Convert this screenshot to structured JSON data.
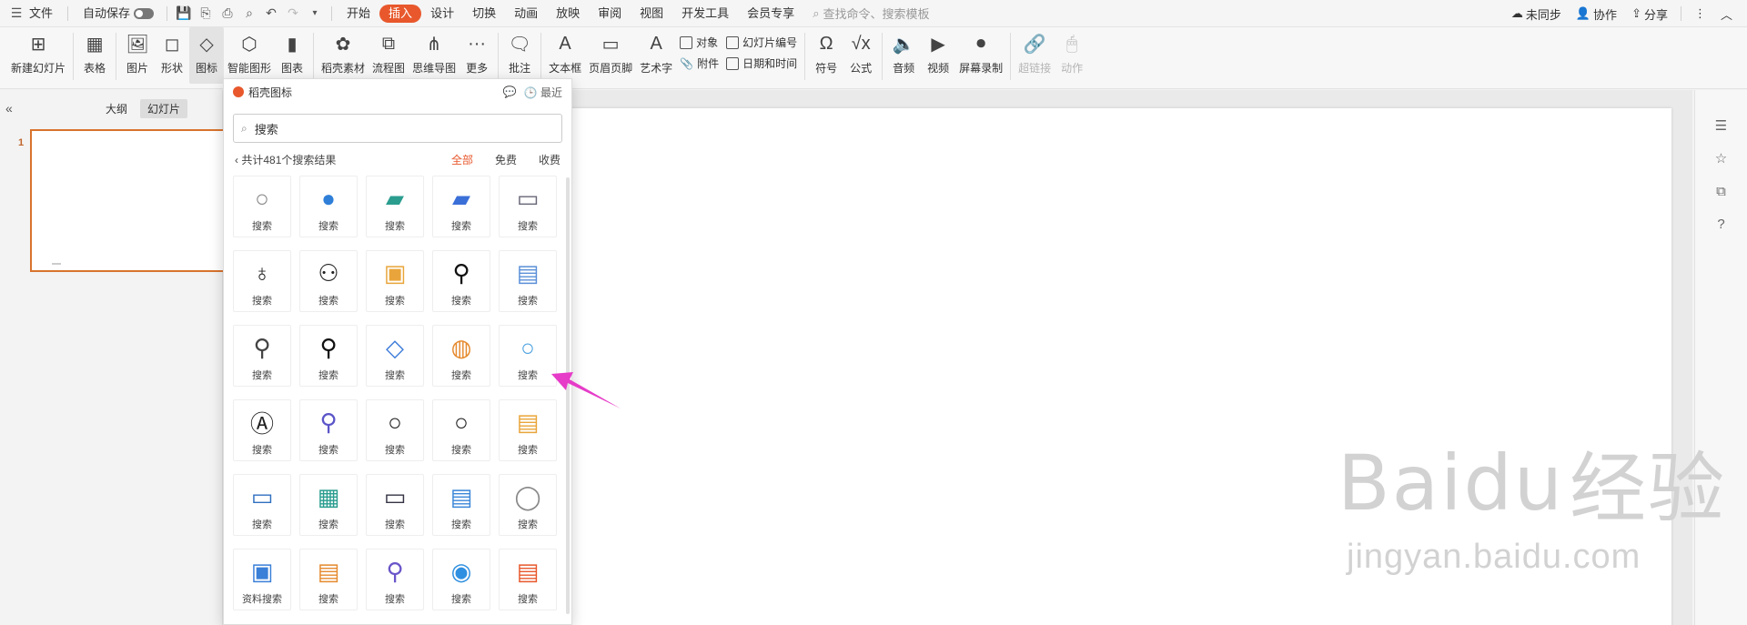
{
  "menubar": {
    "file": "文件",
    "autosave": "自动保存",
    "tabs": [
      {
        "label": "开始",
        "active": false
      },
      {
        "label": "插入",
        "active": true
      },
      {
        "label": "设计",
        "active": false
      },
      {
        "label": "切换",
        "active": false
      },
      {
        "label": "动画",
        "active": false
      },
      {
        "label": "放映",
        "active": false
      },
      {
        "label": "审阅",
        "active": false
      },
      {
        "label": "视图",
        "active": false
      },
      {
        "label": "开发工具",
        "active": false
      },
      {
        "label": "会员专享",
        "active": false
      }
    ],
    "search_placeholder": "查找命令、搜索模板",
    "sync": "未同步",
    "collab": "协作",
    "share": "分享"
  },
  "ribbon": {
    "new_slide": "新建幻灯片",
    "table": "表格",
    "picture": "图片",
    "shape": "形状",
    "icon": "图标",
    "smart_graphic": "智能图形",
    "chart": "图表",
    "assets": "稻壳素材",
    "flowchart": "流程图",
    "mindmap": "思维导图",
    "more": "更多",
    "comment": "批注",
    "textbox": "文本框",
    "header_footer": "页眉页脚",
    "wordart": "艺术字",
    "object": "对象",
    "attachment": "附件",
    "slide_number": "幻灯片编号",
    "datetime": "日期和时间",
    "symbol": "符号",
    "formula": "公式",
    "audio": "音频",
    "video": "视频",
    "screen_record": "屏幕录制",
    "hyperlink": "超链接",
    "action": "动作"
  },
  "leftpanel": {
    "outline": "大纲",
    "slides": "幻灯片",
    "slide_number": "1"
  },
  "popup": {
    "title": "稻壳图标",
    "recent": "最近",
    "search_value": "搜索",
    "result_count": "共计481个搜索结果",
    "filter_all": "全部",
    "filter_free": "免费",
    "filter_paid": "收费",
    "icons": [
      {
        "label": "搜索",
        "icon": "pin-magnifier-icon"
      },
      {
        "label": "搜索",
        "icon": "blue-magnifier-icon"
      },
      {
        "label": "搜索",
        "icon": "teal-folder-search-icon"
      },
      {
        "label": "搜索",
        "icon": "blue-folder-search-icon"
      },
      {
        "label": "搜索",
        "icon": "browser-search-icon"
      },
      {
        "label": "搜索",
        "icon": "person-key-icon"
      },
      {
        "label": "搜索",
        "icon": "users-search-icon"
      },
      {
        "label": "搜索",
        "icon": "yellow-window-search-icon"
      },
      {
        "label": "搜索",
        "icon": "black-magnifier-bold-icon"
      },
      {
        "label": "搜索",
        "icon": "document-search-icon"
      },
      {
        "label": "搜索",
        "icon": "thin-magnifier-icon"
      },
      {
        "label": "搜索",
        "icon": "black-magnifier-icon"
      },
      {
        "label": "搜索",
        "icon": "blue-pin-icon"
      },
      {
        "label": "搜索",
        "icon": "globe-magnifier-icon"
      },
      {
        "label": "搜索",
        "icon": "light-blue-magnifier-icon"
      },
      {
        "label": "搜索",
        "icon": "letter-a-magnifier-icon"
      },
      {
        "label": "搜索",
        "icon": "purple-magnifier-icon"
      },
      {
        "label": "搜索",
        "icon": "outline-magnifier-icon"
      },
      {
        "label": "搜索",
        "icon": "outline-magnifier-2-icon"
      },
      {
        "label": "搜索",
        "icon": "notes-magnifier-icon"
      },
      {
        "label": "搜索",
        "icon": "monitor-chart-icon"
      },
      {
        "label": "搜索",
        "icon": "teal-analysis-icon"
      },
      {
        "label": "搜索",
        "icon": "card-search-icon"
      },
      {
        "label": "搜索",
        "icon": "report-magnifier-icon"
      },
      {
        "label": "搜索",
        "icon": "sketch-magnifier-icon"
      },
      {
        "label": "资料搜索",
        "icon": "screen-search-icon"
      },
      {
        "label": "搜索",
        "icon": "web-doc-icon"
      },
      {
        "label": "搜索",
        "icon": "purple-tilted-magnifier-icon"
      },
      {
        "label": "搜索",
        "icon": "blue-circle-search-icon"
      },
      {
        "label": "搜索",
        "icon": "doc-orange-magnifier-icon"
      }
    ]
  },
  "watermark": {
    "brand": "Baidu",
    "cn": "经验",
    "url": "jingyan.baidu.com"
  },
  "colors": {
    "accent": "#e8582c",
    "arrow": "#e63cc8"
  }
}
